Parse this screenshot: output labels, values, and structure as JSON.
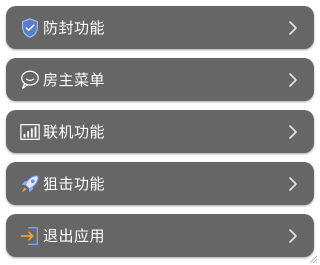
{
  "menu": {
    "items": [
      {
        "label": "防封功能",
        "icon": "shield-icon"
      },
      {
        "label": "房主菜单",
        "icon": "chat-icon"
      },
      {
        "label": "联机功能",
        "icon": "signal-icon"
      },
      {
        "label": "狙击功能",
        "icon": "rocket-icon"
      },
      {
        "label": "退出应用",
        "icon": "exit-icon"
      }
    ],
    "chevron_icon": "chevron-right-icon"
  },
  "colors": {
    "item_background": "#666666",
    "label_text": "#ffffff",
    "icon_accent": "#6f8fd8",
    "page_background": "#ffffff"
  }
}
